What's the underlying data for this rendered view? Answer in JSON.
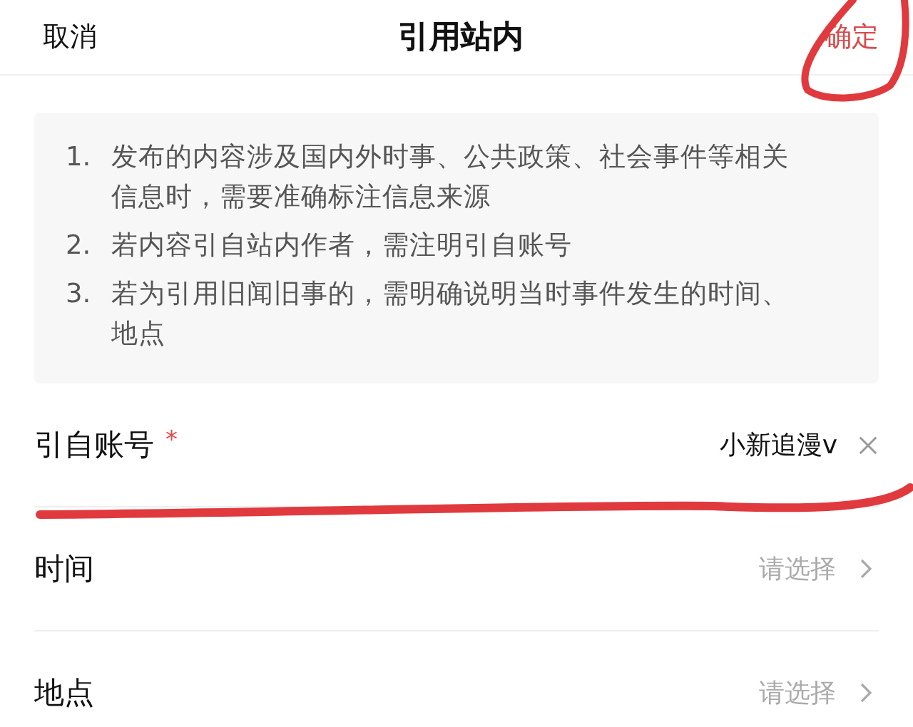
{
  "header": {
    "cancel": "取消",
    "title": "引用站内",
    "confirm": "确定"
  },
  "notice": {
    "items": [
      {
        "number": "1.",
        "text": "发布的内容涉及国内外时事、公共政策、社会事件等相关信息时，需要准确标注信息来源"
      },
      {
        "number": "2.",
        "text": "若内容引自站内作者，需注明引自账号"
      },
      {
        "number": "3.",
        "text": "若为引用旧闻旧事的，需明确说明当时事件发生的时间、地点"
      }
    ]
  },
  "fields": [
    {
      "kind": "value",
      "label": "引自账号",
      "required_mark": "*",
      "value": "小新追漫v"
    },
    {
      "kind": "select",
      "label": "时间",
      "placeholder": "请选择"
    },
    {
      "kind": "select",
      "label": "地点",
      "placeholder": "请选择"
    }
  ]
}
